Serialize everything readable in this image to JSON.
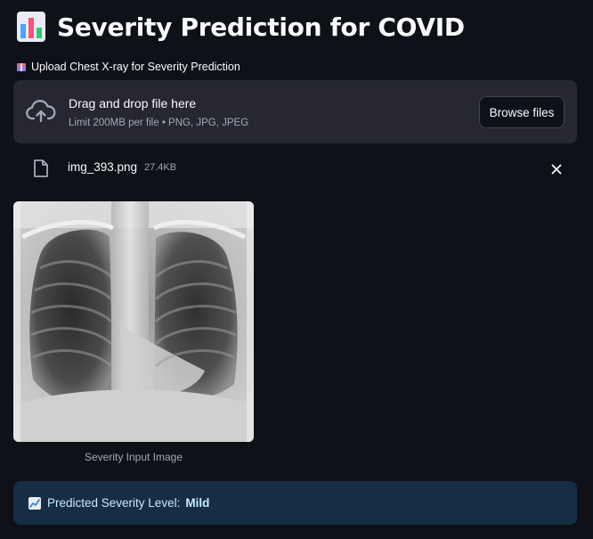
{
  "header": {
    "title": "Severity Prediction for COVID",
    "icon": "bar-chart-icon"
  },
  "uploader": {
    "label": "Upload Chest X-ray for Severity Prediction",
    "label_icon": "package-icon",
    "drop_text": "Drag and drop file here",
    "limit_text": "Limit 200MB per file • PNG, JPG, JPEG",
    "browse_label": "Browse files"
  },
  "file": {
    "name": "img_393.png",
    "size": "27.4KB"
  },
  "image": {
    "caption": "Severity Input Image"
  },
  "result": {
    "icon": "chart-increasing-icon",
    "prefix": "Predicted Severity Level:",
    "value": "Mild"
  },
  "colors": {
    "background": "#0e1117",
    "panel": "#262730",
    "info_bg": "#172d43",
    "info_text": "#c7ebff",
    "muted": "#a3a8b8"
  }
}
